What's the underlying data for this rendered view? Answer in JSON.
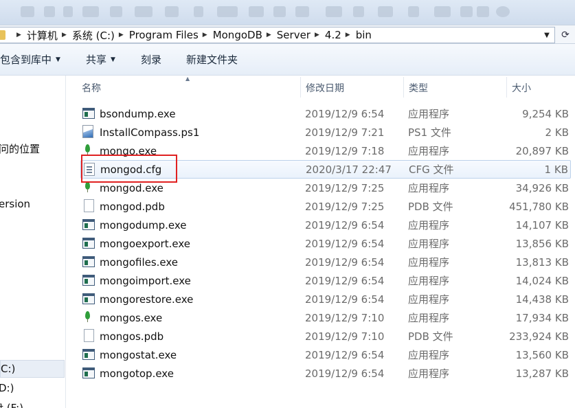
{
  "address": {
    "crumbs": [
      "计算机",
      "系统 (C:)",
      "Program Files",
      "MongoDB",
      "Server",
      "4.2",
      "bin"
    ]
  },
  "toolbar": {
    "include_in_library": "包含到库中",
    "share": "共享",
    "burn": "刻录",
    "new_folder": "新建文件夹"
  },
  "nav": {
    "items": [
      "问的位置",
      "ersion",
      "C:)",
      "D:)",
      "盘 (F:)"
    ],
    "selected_item": "C:)"
  },
  "columns": {
    "name": "名称",
    "date": "修改日期",
    "type": "类型",
    "size": "大小"
  },
  "files": [
    {
      "name": "bsondump.exe",
      "date": "2019/12/9 6:54",
      "type": "应用程序",
      "size": "9,254 KB",
      "icon": "exe-icon"
    },
    {
      "name": "InstallCompass.ps1",
      "date": "2019/12/9 7:21",
      "type": "PS1 文件",
      "size": "2 KB",
      "icon": "ps1-file-icon"
    },
    {
      "name": "mongo.exe",
      "date": "2019/12/9 7:18",
      "type": "应用程序",
      "size": "20,897 KB",
      "icon": "mongodb-leaf-icon"
    },
    {
      "name": "mongod.cfg",
      "date": "2020/3/17 22:47",
      "type": "CFG 文件",
      "size": "1 KB",
      "icon": "cfg-file-icon"
    },
    {
      "name": "mongod.exe",
      "date": "2019/12/9 7:25",
      "type": "应用程序",
      "size": "34,926 KB",
      "icon": "mongodb-leaf-icon"
    },
    {
      "name": "mongod.pdb",
      "date": "2019/12/9 7:25",
      "type": "PDB 文件",
      "size": "451,780 KB",
      "icon": "document-icon"
    },
    {
      "name": "mongodump.exe",
      "date": "2019/12/9 6:54",
      "type": "应用程序",
      "size": "14,107 KB",
      "icon": "exe-icon"
    },
    {
      "name": "mongoexport.exe",
      "date": "2019/12/9 6:54",
      "type": "应用程序",
      "size": "13,856 KB",
      "icon": "exe-icon"
    },
    {
      "name": "mongofiles.exe",
      "date": "2019/12/9 6:54",
      "type": "应用程序",
      "size": "13,813 KB",
      "icon": "exe-icon"
    },
    {
      "name": "mongoimport.exe",
      "date": "2019/12/9 6:54",
      "type": "应用程序",
      "size": "14,024 KB",
      "icon": "exe-icon"
    },
    {
      "name": "mongorestore.exe",
      "date": "2019/12/9 6:54",
      "type": "应用程序",
      "size": "14,438 KB",
      "icon": "exe-icon"
    },
    {
      "name": "mongos.exe",
      "date": "2019/12/9 7:10",
      "type": "应用程序",
      "size": "17,934 KB",
      "icon": "mongodb-leaf-icon"
    },
    {
      "name": "mongos.pdb",
      "date": "2019/12/9 7:10",
      "type": "PDB 文件",
      "size": "233,924 KB",
      "icon": "document-icon"
    },
    {
      "name": "mongostat.exe",
      "date": "2019/12/9 6:54",
      "type": "应用程序",
      "size": "13,560 KB",
      "icon": "exe-icon"
    },
    {
      "name": "mongotop.exe",
      "date": "2019/12/9 6:54",
      "type": "应用程序",
      "size": "13,287 KB",
      "icon": "exe-icon"
    }
  ],
  "highlight": {
    "row_name": "mongod.cfg",
    "annotation_color": "#e02020"
  }
}
